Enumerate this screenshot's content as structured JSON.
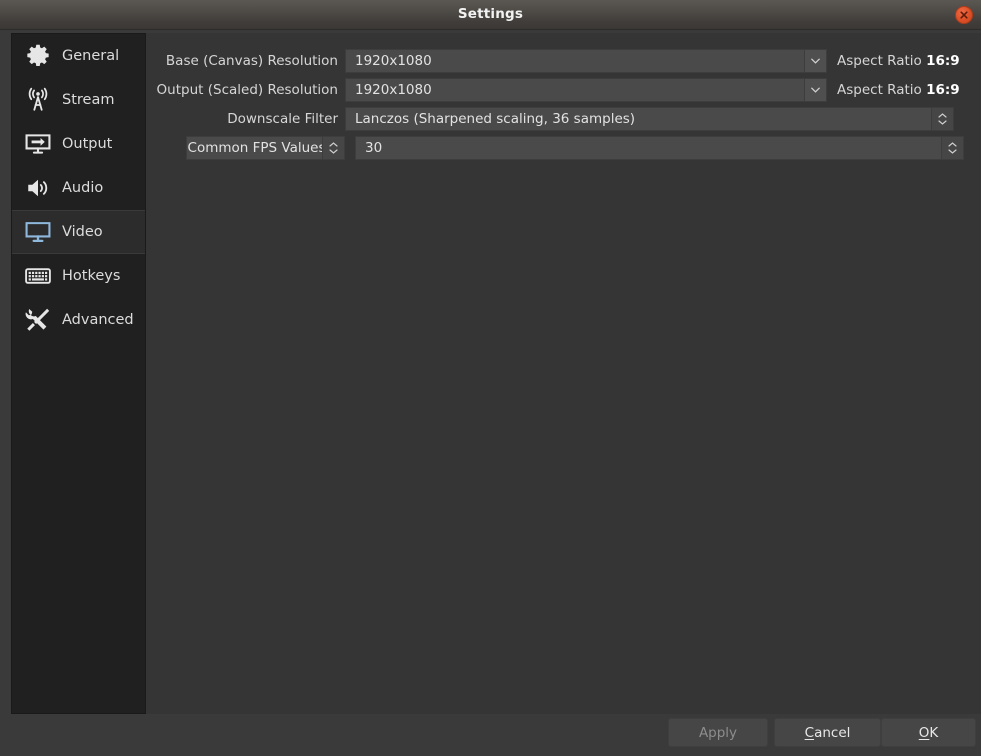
{
  "window": {
    "title": "Settings",
    "close_icon": "close-icon"
  },
  "colors": {
    "dialog_bg": "#3a3a3a",
    "panel_bg": "#353535",
    "sidebar_bg": "#202020",
    "selected_bg": "#2c2c2c",
    "field_bg": "#4a4a4a",
    "accent_close": "#dd4f26",
    "selected_icon": "#8fb8dd",
    "text": "#d8d8d8"
  },
  "sidebar": {
    "items": [
      {
        "label": "General",
        "icon": "gear-icon",
        "selected": false
      },
      {
        "label": "Stream",
        "icon": "broadcast-icon",
        "selected": false
      },
      {
        "label": "Output",
        "icon": "output-icon",
        "selected": false
      },
      {
        "label": "Audio",
        "icon": "speaker-icon",
        "selected": false
      },
      {
        "label": "Video",
        "icon": "monitor-icon",
        "selected": true
      },
      {
        "label": "Hotkeys",
        "icon": "keyboard-icon",
        "selected": false
      },
      {
        "label": "Advanced",
        "icon": "tools-icon",
        "selected": false
      }
    ]
  },
  "video_settings": {
    "base_resolution": {
      "label": "Base (Canvas) Resolution",
      "value": "1920x1080",
      "aspect_label": "Aspect Ratio",
      "aspect_value": "16:9"
    },
    "output_resolution": {
      "label": "Output (Scaled) Resolution",
      "value": "1920x1080",
      "aspect_label": "Aspect Ratio",
      "aspect_value": "16:9"
    },
    "downscale_filter": {
      "label": "Downscale Filter",
      "value": "Lanczos (Sharpened scaling, 36 samples)"
    },
    "fps": {
      "mode_label": "Common FPS Values",
      "value": "30"
    }
  },
  "buttons": {
    "apply": {
      "label": "Apply",
      "enabled": false
    },
    "cancel": {
      "label": "Cancel",
      "mnemonic": "C"
    },
    "ok": {
      "label": "OK",
      "mnemonic": "O"
    }
  }
}
